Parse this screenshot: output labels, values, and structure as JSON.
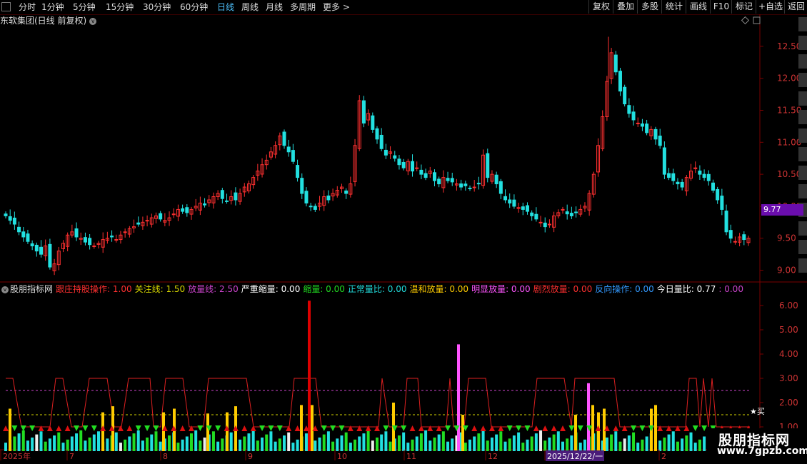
{
  "toolbar": {
    "periods": [
      "分时",
      "1分钟",
      "5分钟",
      "15分钟",
      "30分钟",
      "60分钟",
      "日线",
      "周线",
      "月线",
      "多周期",
      "更多 >"
    ],
    "active_period": "日线",
    "right_buttons": [
      "复权",
      "叠加",
      "多股",
      "统计",
      "画线",
      "F10",
      "标记",
      "+自选",
      "返回"
    ]
  },
  "chart": {
    "title": "东软集团(日线 前复权)",
    "y_ticks": [
      "12.50",
      "12.00",
      "11.50",
      "11.00",
      "10.50",
      "10.00",
      "9.50",
      "9.00"
    ],
    "current_price": "9.77"
  },
  "indicator": {
    "name": "股朋指标网",
    "items": [
      {
        "label": "跟庄持股操作: 1.00",
        "color": "#ff3030"
      },
      {
        "label": "关注线: 1.50",
        "color": "#d4d400"
      },
      {
        "label": "放量线: 2.50",
        "color": "#cc44cc"
      },
      {
        "label": "严重缩量: 0.00",
        "color": "#ffffff"
      },
      {
        "label": "缩量: 0.00",
        "color": "#22dd22"
      },
      {
        "label": "正常量比: 0.00",
        "color": "#22dddd"
      },
      {
        "label": "温和放量: 0.00",
        "color": "#ffcc00"
      },
      {
        "label": "明显放量: 0.00",
        "color": "#ff55ff"
      },
      {
        "label": "剧烈放量: 0.00",
        "color": "#ff3030"
      },
      {
        "label": "反向操作: 0.00",
        "color": "#3399ff"
      },
      {
        "label": "今日量比: 0.77",
        "color": "#ffffff"
      },
      {
        "label": ": 0.00",
        "color": "#cc44cc"
      }
    ],
    "y_ticks": [
      "6.00",
      "5.00",
      "4.00",
      "3.00",
      "2.00",
      "1.00"
    ],
    "buy_mark": "★买",
    "vol_values": [
      6.2,
      4.4,
      2.8
    ]
  },
  "date_axis": {
    "labels": [
      "2025年",
      "7",
      "8",
      "9",
      "10",
      "11",
      "12",
      "2025/12/22/一",
      "2"
    ],
    "highlight": "2025/12/22/一"
  },
  "brand": {
    "line1": "股朋指标网",
    "line2": "www.7gpzb.com"
  },
  "colors": {
    "up": "#ff3030",
    "down": "#22e0e0",
    "grid": "#5a0000"
  }
}
